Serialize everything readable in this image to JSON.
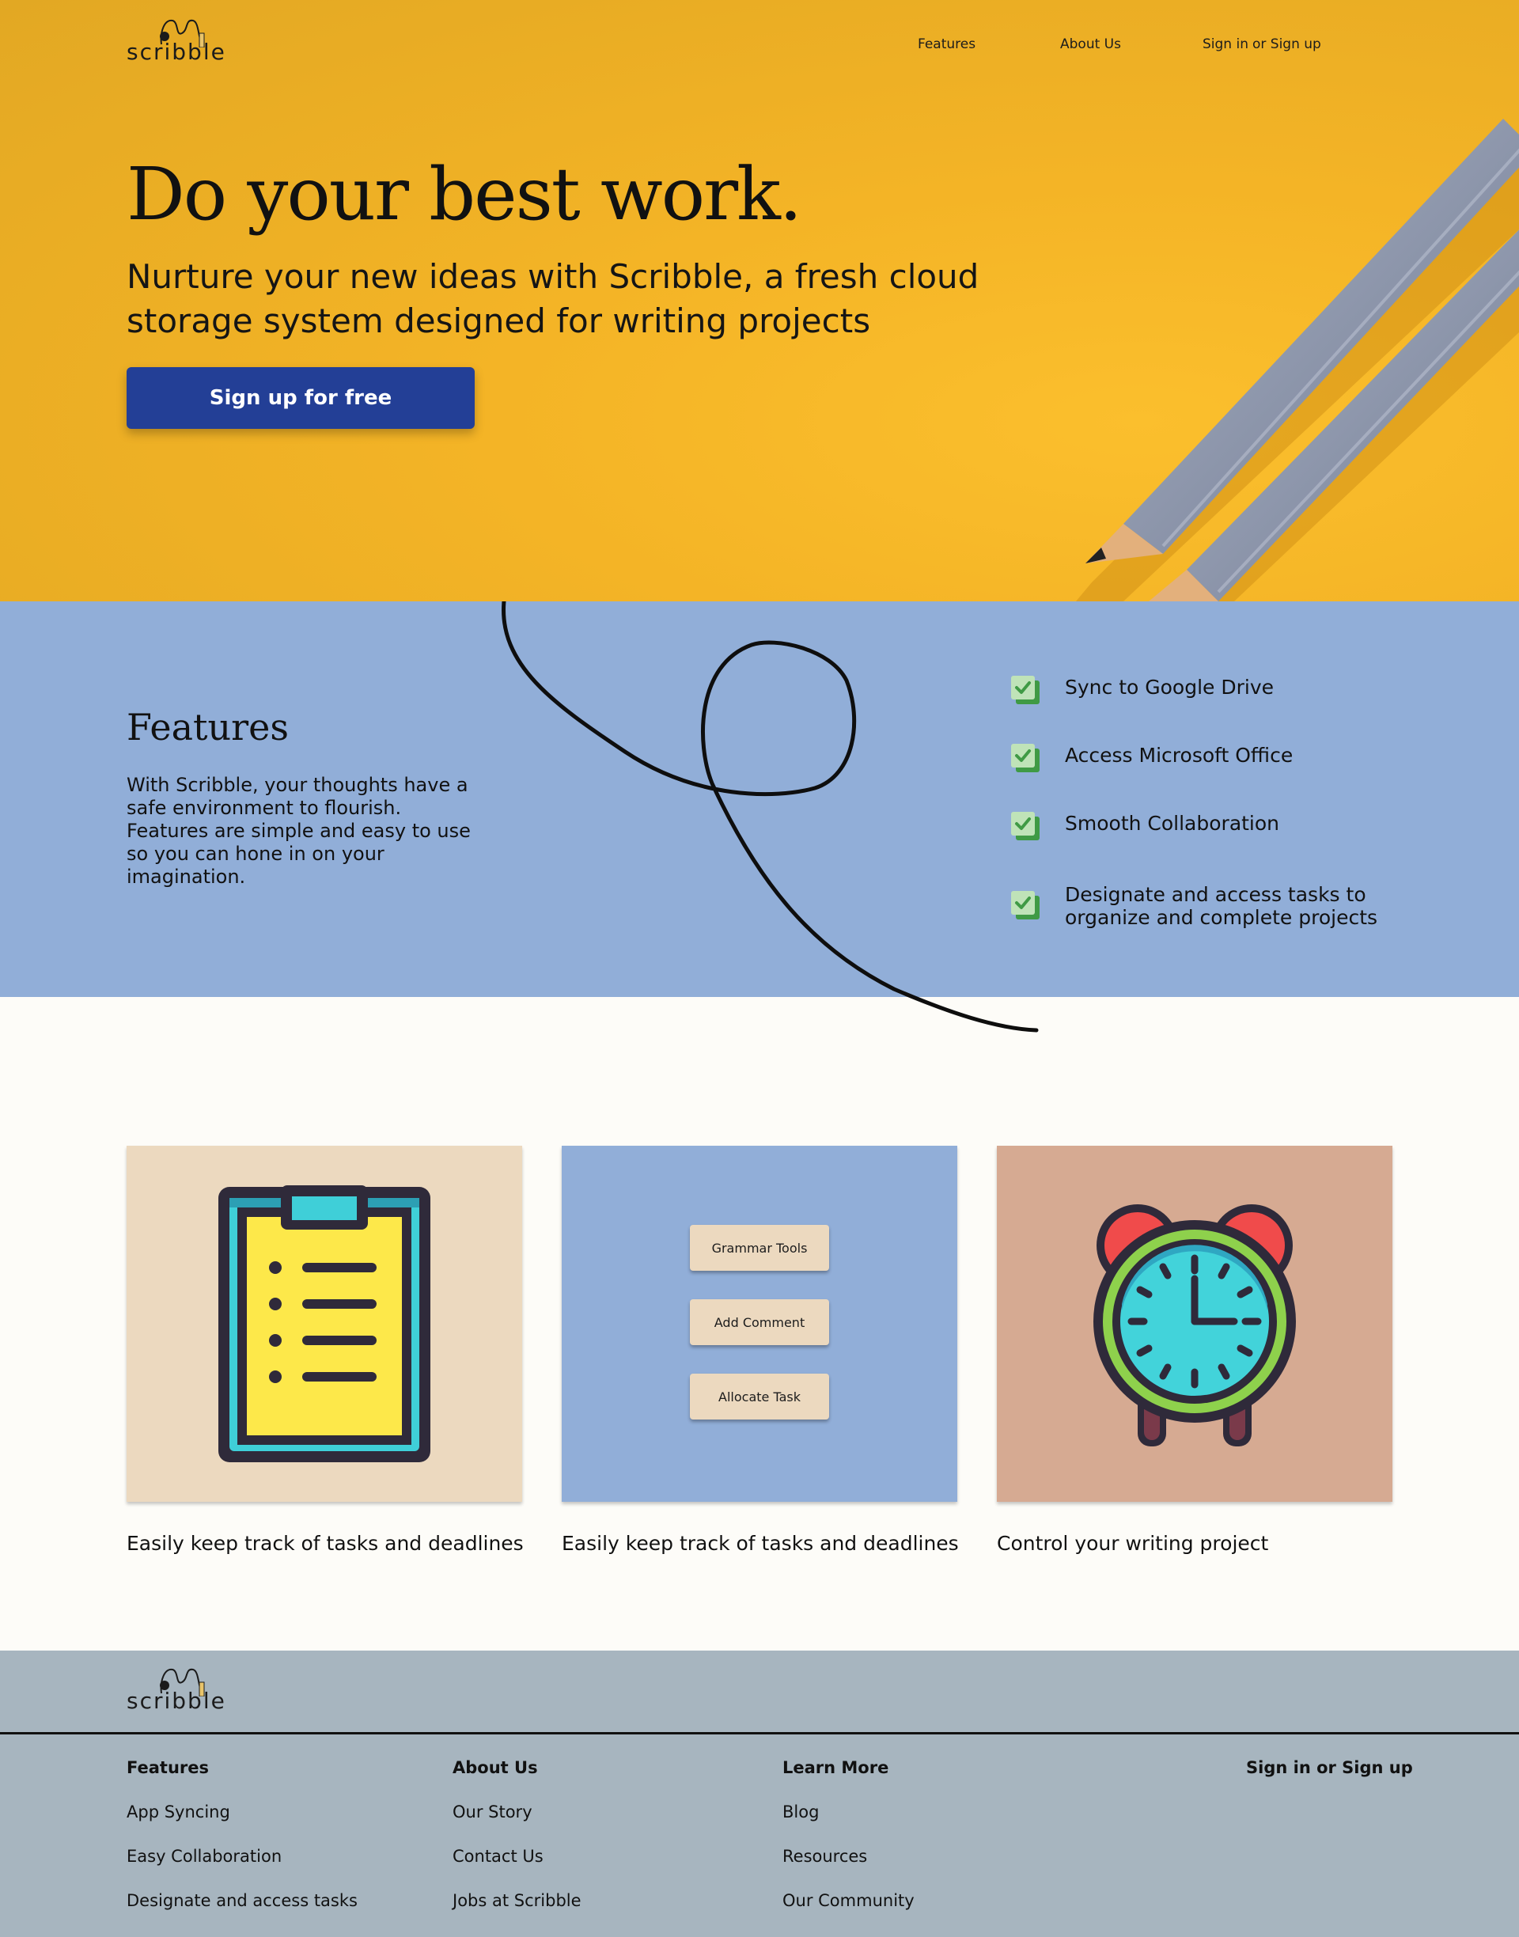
{
  "brand": {
    "logo_text": "scribble"
  },
  "nav": {
    "features": "Features",
    "about": "About Us",
    "signin": "Sign in",
    "signup": "or Sign up"
  },
  "hero": {
    "title": "Do your best work.",
    "subtitle": "Nurture your new ideas with Scribble, a fresh cloud storage system designed for writing projects",
    "cta": "Sign up for free"
  },
  "features": {
    "heading": "Features",
    "description": "With Scribble, your thoughts have a safe environment to flourish. Features are simple and easy to use so you can hone in on your imagination.",
    "items": [
      {
        "label": "Sync to Google Drive",
        "icon": "checkbox-icon"
      },
      {
        "label": "Access Microsoft Office",
        "icon": "checkbox-icon"
      },
      {
        "label": "Smooth Collaboration",
        "icon": "checkbox-icon"
      },
      {
        "label": "Designate and access tasks to organize and complete projects",
        "icon": "checkbox-icon"
      }
    ]
  },
  "cards": [
    {
      "icon": "clipboard-icon",
      "bg": "#ecd9bf",
      "caption": "Easily keep track of tasks and deadlines"
    },
    {
      "icon": "buttons-mockup",
      "bg": "#91aed8",
      "caption": "Easily keep track of tasks and deadlines",
      "buttons": [
        "Grammar Tools",
        "Add Comment",
        "Allocate Task"
      ]
    },
    {
      "icon": "alarm-clock-icon",
      "bg": "#d6aa92",
      "caption": "Control your writing project"
    }
  ],
  "footer": {
    "logo_text": "scribble",
    "columns": [
      {
        "heading": "Features",
        "links": [
          "App Syncing",
          "Easy Collaboration",
          "Designate and access tasks"
        ]
      },
      {
        "heading": "About Us",
        "links": [
          "Our Story",
          "Contact Us",
          "Jobs at Scribble"
        ]
      },
      {
        "heading": "Learn More",
        "links": [
          "Blog",
          "Resources",
          "Our Community"
        ]
      },
      {
        "heading": "Sign in or Sign up",
        "links": []
      }
    ]
  },
  "colors": {
    "hero_bg": "#f4b426",
    "cta_bg": "#233f96",
    "features_bg": "#91aed8",
    "footer_bg": "#a7b5bf",
    "check_green": "#4caf50"
  }
}
